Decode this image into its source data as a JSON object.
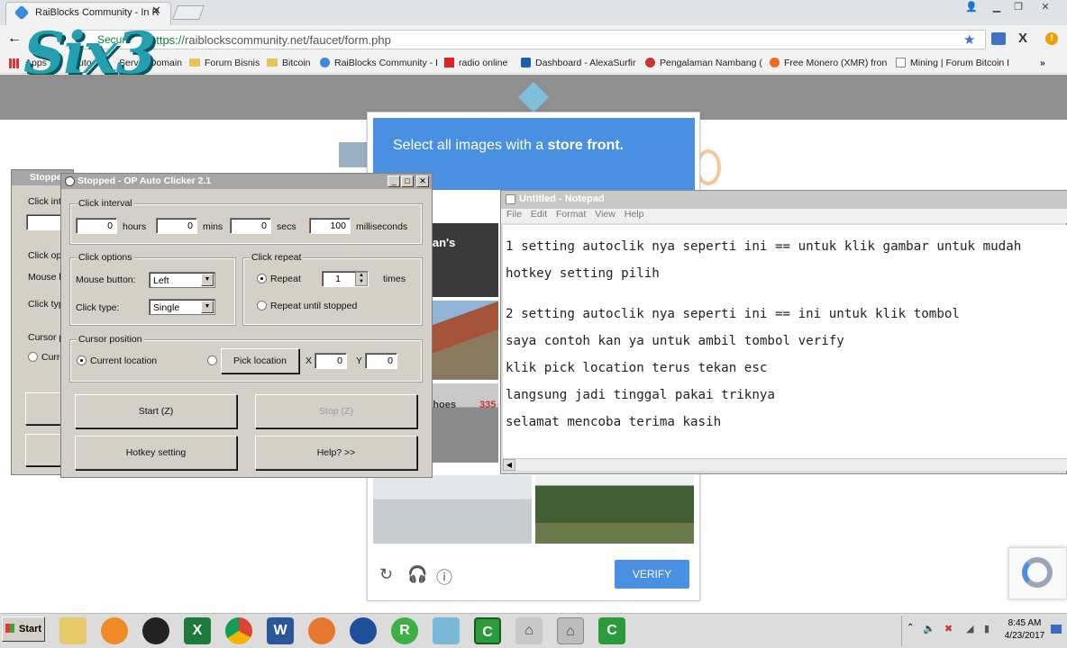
{
  "browser": {
    "tab_title": "RaiBlocks Community - In R",
    "url_scheme": "https://",
    "url_rest": "raiblockscommunity.net/faucet/form.php",
    "secure_label": "Secure"
  },
  "bookmarks": [
    "Apps",
    "Auto",
    "Server Domain",
    "Forum Bisnis",
    "Bitcoin",
    "RaiBlocks Community - I",
    "radio online",
    "Dashboard - AlexaSurfir",
    "Pengalaman Nambang (",
    "Free Monero (XMR) fron",
    "Mining | Forum Bitcoin I"
  ],
  "watermark": "Six3",
  "captcha": {
    "instruction_prefix": "Select all images with a ",
    "instruction_bold": "store front.",
    "verify_label": "VERIFY",
    "tile_texts": [
      "erman's",
      "ominhoes",
      "335"
    ]
  },
  "notepad": {
    "title": "Untitled - Notepad",
    "menu": [
      "File",
      "Edit",
      "Format",
      "View",
      "Help"
    ],
    "lines": [
      "1 setting autoclik nya seperti ini == untuk klik gambar untuk mudah",
      "hotkey setting pilih",
      "2 setting autoclik nya seperti ini == ini untuk klik tombol",
      "saya contoh kan ya untuk ambil tombol verify",
      "klik pick location terus tekan esc",
      "langsung jadi tinggal pakai triknya",
      "selamat mencoba terima kasih"
    ]
  },
  "clicker_back": {
    "title": "Stoppe",
    "interval_label": "Click inte",
    "options_label": "Click op",
    "mouse_label": "Mouse b",
    "type_label": "Click typ",
    "cursor_label": "Cursor p",
    "current_label": "Curre"
  },
  "clicker": {
    "title": "Stopped - OP Auto Clicker 2.1",
    "interval": {
      "label": "Click interval",
      "hours": "0",
      "hours_label": "hours",
      "mins": "0",
      "mins_label": "mins",
      "secs": "0",
      "secs_label": "secs",
      "ms": "100",
      "ms_label": "milliseconds"
    },
    "options": {
      "label": "Click options",
      "mouse_label": "Mouse button:",
      "mouse_value": "Left",
      "type_label": "Click type:",
      "type_value": "Single"
    },
    "repeat": {
      "label": "Click repeat",
      "repeat_label": "Repeat",
      "repeat_value": "1",
      "times_label": "times",
      "until_label": "Repeat until stopped"
    },
    "cursor": {
      "label": "Cursor position",
      "current_label": "Current location",
      "pick_label": "Pick location",
      "x_label": "X",
      "x_value": "0",
      "y_label": "Y",
      "y_value": "0"
    },
    "start_label": "Start (Z)",
    "stop_label": "Stop (Z)",
    "hotkey_label": "Hotkey setting",
    "help_label": "Help? >>"
  },
  "taskbar": {
    "start_label": "Start",
    "time": "8:45 AM",
    "date": "4/23/2017"
  }
}
